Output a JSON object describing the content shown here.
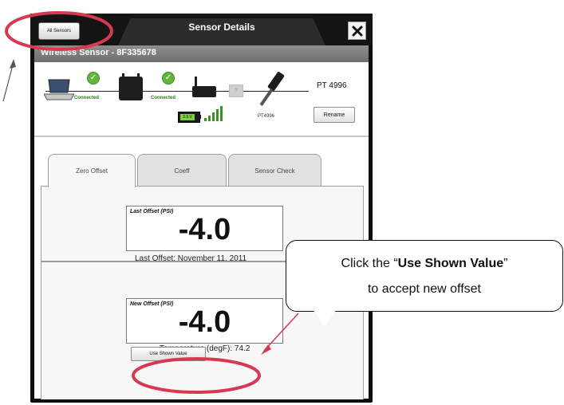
{
  "window": {
    "back_button": "All Sensors",
    "title": "Sensor Details",
    "close_glyph": "X"
  },
  "sensor": {
    "header": "Wireless Sensor - 8F335678",
    "status_1": "Connected",
    "status_2": "Connected",
    "relay_box": "?",
    "battery_text": "3.9 V",
    "probe_label": "PT4996",
    "id": "PT 4996",
    "rename_button": "Rename"
  },
  "tabs": [
    {
      "label": "Zero Offset",
      "active": true
    },
    {
      "label": "Coeff",
      "active": false
    },
    {
      "label": "Sensor Check",
      "active": false
    }
  ],
  "last_offset": {
    "label": "Last Offset (PSI)",
    "value": "-4.0",
    "caption": "Last Offset: November 11, 2011"
  },
  "new_offset": {
    "label": "New Offset (PSI)",
    "value": "-4.0",
    "caption": "Temperature (degF): 74.2"
  },
  "use_button": "Use Shown Value",
  "callout": {
    "prefix": "Click the “",
    "bold": "Use Shown Value",
    "suffix": "”",
    "line2": "to accept new offset"
  },
  "colors": {
    "highlight_ring": "#d63a52",
    "connected_green": "#63b63a",
    "window_dark": "#0e0e0e"
  },
  "icons": [
    "laptop-icon",
    "router-icon",
    "gateway-icon",
    "probe-icon",
    "check-icon",
    "battery-icon",
    "signal-icon",
    "close-icon"
  ]
}
